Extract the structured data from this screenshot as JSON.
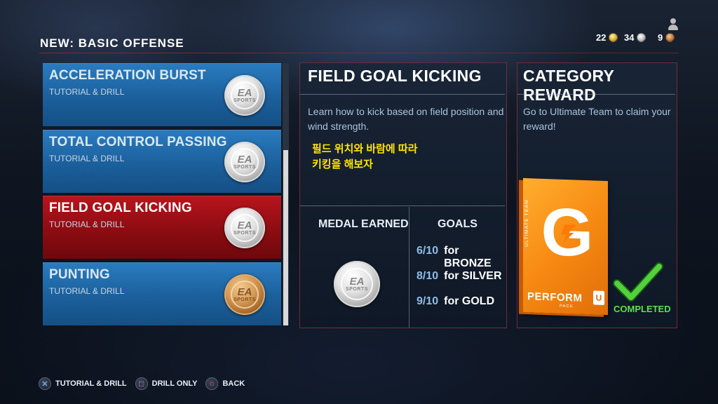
{
  "header": {
    "title": "NEW: BASIC OFFENSE",
    "currency": [
      {
        "value": "22",
        "icon": "gold-coin-icon"
      },
      {
        "value": "34",
        "icon": "silver-coin-icon"
      },
      {
        "value": "9",
        "icon": "bronze-coin-icon"
      }
    ]
  },
  "drills": [
    {
      "name": "ACCELERATION BURST",
      "subtitle": "TUTORIAL & DRILL",
      "medal": "silver",
      "medal_text": "EA",
      "medal_sub": "SPORTS"
    },
    {
      "name": "TOTAL CONTROL PASSING",
      "subtitle": "TUTORIAL & DRILL",
      "medal": "silver",
      "medal_text": "EA",
      "medal_sub": "SPORTS"
    },
    {
      "name": "FIELD GOAL KICKING",
      "subtitle": "TUTORIAL & DRILL",
      "medal": "silver",
      "medal_text": "EA",
      "medal_sub": "SPORTS",
      "selected": true
    },
    {
      "name": "PUNTING",
      "subtitle": "TUTORIAL & DRILL",
      "medal": "bronze",
      "medal_text": "EA",
      "medal_sub": "SPORTS"
    }
  ],
  "detail": {
    "title": "FIELD GOAL KICKING",
    "description_line1": "Learn how to kick based on field position and",
    "description_line2": "wind strength.",
    "subtitle_ko_line1": "필드 위치와 바람에 따라",
    "subtitle_ko_line2": "키킹을 해보자",
    "medal_earned_label": "MEDAL EARNED",
    "medal_text": "EA",
    "medal_sub": "SPORTS",
    "goals_label": "GOALS",
    "goals": [
      {
        "fraction": "6/10",
        "tier": "for BRONZE"
      },
      {
        "fraction": "8/10",
        "tier": "for SILVER"
      },
      {
        "fraction": "9/10",
        "tier": "for GOLD"
      }
    ]
  },
  "reward": {
    "title": "CATEGORY REWARD",
    "description_line1": "Go to Ultimate Team to claim your",
    "description_line2": "reward!",
    "pack_side_label": "ULTIMATE TEAM",
    "pack_logo": "G",
    "pack_name": "PERFORM",
    "pack_sub": "PACK",
    "pack_badge": "U",
    "status": "COMPLETED",
    "status_color": "#5de04a"
  },
  "footer": {
    "hints": [
      {
        "button": "cross",
        "symbol": "✕",
        "color": "#6fa8e8",
        "label": "TUTORIAL & DRILL"
      },
      {
        "button": "square",
        "symbol": "□",
        "color": "#d46fd0",
        "label": "DRILL ONLY"
      },
      {
        "button": "circle",
        "symbol": "○",
        "color": "#e8505a",
        "label": "BACK"
      }
    ]
  }
}
